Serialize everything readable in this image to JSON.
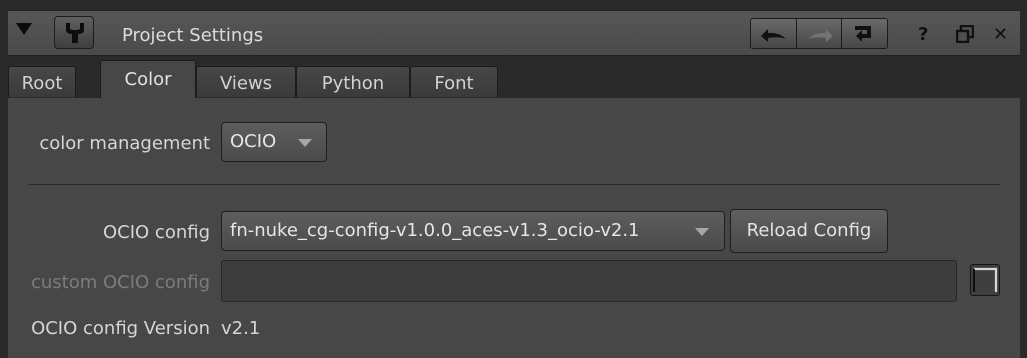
{
  "panel": {
    "title": "Project Settings"
  },
  "tabs": [
    {
      "label": "Root"
    },
    {
      "label": "Color"
    },
    {
      "label": "Views"
    },
    {
      "label": "Python"
    },
    {
      "label": "Font"
    }
  ],
  "active_tab": "Color",
  "color_section": {
    "color_management_label": "color management",
    "color_management_value": "OCIO",
    "ocio_config_label": "OCIO config",
    "ocio_config_value": "fn-nuke_cg-config-v1.0.0_aces-v1.3_ocio-v2.1",
    "reload_button_label": "Reload Config",
    "custom_config_label": "custom OCIO config",
    "custom_config_value": "",
    "config_version_label": "OCIO config Version",
    "config_version_value": "v2.1"
  },
  "icons": {
    "collapse": "collapse-triangle-icon",
    "node": "wrench-icon",
    "undo": "undo-icon",
    "redo": "redo-icon",
    "revert": "revert-icon",
    "help": "help-icon",
    "float": "float-window-icon",
    "close": "close-icon",
    "folder": "folder-icon"
  },
  "colors": {
    "panel_bg": "#474747",
    "titlebar_bg": "#4f4f4f",
    "text": "#d6d6d6",
    "disabled_text": "#7c7c7c"
  }
}
